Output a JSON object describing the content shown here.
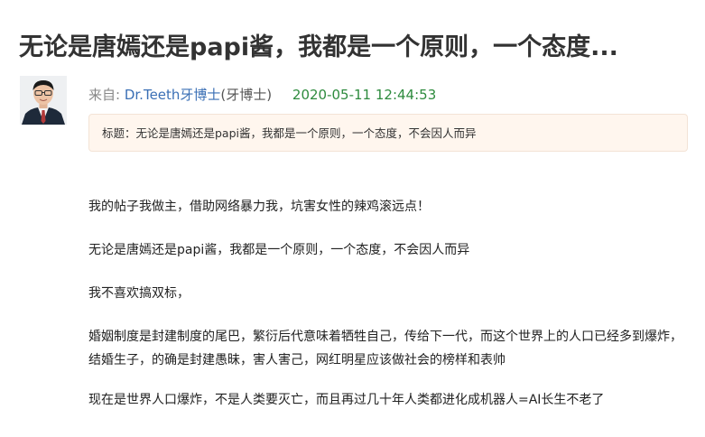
{
  "post": {
    "title": "无论是唐嫣还是papi酱，我都是一个原则，一个态度...",
    "from_label": "来自:",
    "author_name": "Dr.Teeth牙博士",
    "author_paren": "(牙博士)",
    "date": "2020-05-11 12:44:53",
    "subject": "标题：无论是唐嫣还是papi酱，我都是一个原则，一个态度，不会因人而异"
  },
  "content": {
    "paragraphs": [
      "我的帖子我做主，借助网络暴力我，坑害女性的辣鸡滚远点！",
      "无论是唐嫣还是papi酱，我都是一个原则，一个态度，不会因人而异",
      "我不喜欢搞双标，",
      "婚姻制度是封建制度的尾巴，繁衍后代意味着牺牲自己，传给下一代，而这个世界上的人口已经多到爆炸，结婚生子，的确是封建愚昧，害人害己，网红明星应该做社会的榜样和表帅",
      "现在是世界人口爆炸，不是人类要灭亡，而且再过几十年人类都进化成机器人=AI长生不老了"
    ]
  }
}
